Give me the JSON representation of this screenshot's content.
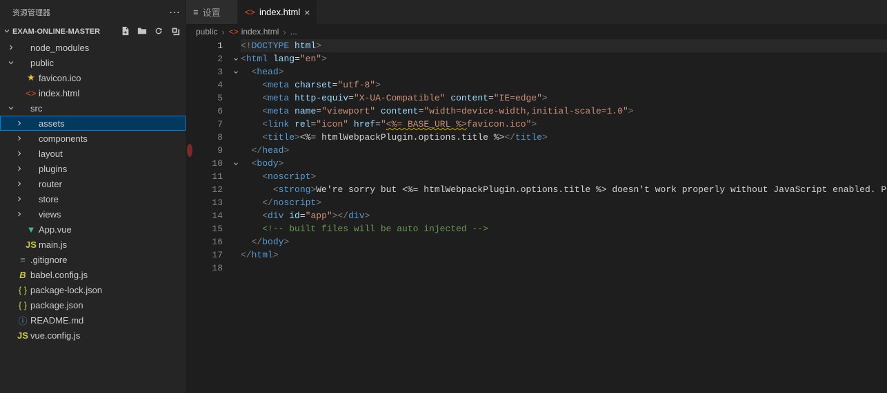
{
  "sidebar": {
    "title": "资源管理器",
    "project_name": "EXAM-ONLINE-MASTER",
    "tree": [
      {
        "label": "node_modules",
        "type": "folder",
        "indent": 0,
        "expanded": false
      },
      {
        "label": "public",
        "type": "folder",
        "indent": 0,
        "expanded": true
      },
      {
        "label": "favicon.ico",
        "type": "file",
        "icon": "star",
        "indent": 1
      },
      {
        "label": "index.html",
        "type": "file",
        "icon": "html",
        "indent": 1
      },
      {
        "label": "src",
        "type": "folder",
        "indent": 0,
        "expanded": true
      },
      {
        "label": "assets",
        "type": "folder",
        "indent": 1,
        "expanded": false,
        "selected": true
      },
      {
        "label": "components",
        "type": "folder",
        "indent": 1,
        "expanded": false
      },
      {
        "label": "layout",
        "type": "folder",
        "indent": 1,
        "expanded": false
      },
      {
        "label": "plugins",
        "type": "folder",
        "indent": 1,
        "expanded": false
      },
      {
        "label": "router",
        "type": "folder",
        "indent": 1,
        "expanded": false
      },
      {
        "label": "store",
        "type": "folder",
        "indent": 1,
        "expanded": false
      },
      {
        "label": "views",
        "type": "folder",
        "indent": 1,
        "expanded": false
      },
      {
        "label": "App.vue",
        "type": "file",
        "icon": "vue",
        "indent": 1
      },
      {
        "label": "main.js",
        "type": "file",
        "icon": "js",
        "indent": 1
      },
      {
        "label": ".gitignore",
        "type": "file",
        "icon": "lines",
        "indent": 0
      },
      {
        "label": "babel.config.js",
        "type": "file",
        "icon": "babel",
        "indent": 0
      },
      {
        "label": "package-lock.json",
        "type": "file",
        "icon": "json",
        "indent": 0
      },
      {
        "label": "package.json",
        "type": "file",
        "icon": "json",
        "indent": 0
      },
      {
        "label": "README.md",
        "type": "file",
        "icon": "info",
        "indent": 0
      },
      {
        "label": "vue.config.js",
        "type": "file",
        "icon": "js",
        "indent": 0
      }
    ]
  },
  "tabs": [
    {
      "label": "设置",
      "icon": "gear",
      "active": false
    },
    {
      "label": "index.html",
      "icon": "html",
      "active": true
    }
  ],
  "breadcrumb": [
    {
      "label": "public",
      "icon": ""
    },
    {
      "label": "index.html",
      "icon": "html"
    },
    {
      "label": "...",
      "icon": ""
    }
  ],
  "editor": {
    "current_line": 1,
    "breakpoint_line": 9,
    "fold_lines": [
      2,
      3,
      10
    ],
    "lines": [
      1,
      2,
      3,
      4,
      5,
      6,
      7,
      8,
      9,
      10,
      11,
      12,
      13,
      14,
      15,
      16,
      17,
      18
    ]
  }
}
